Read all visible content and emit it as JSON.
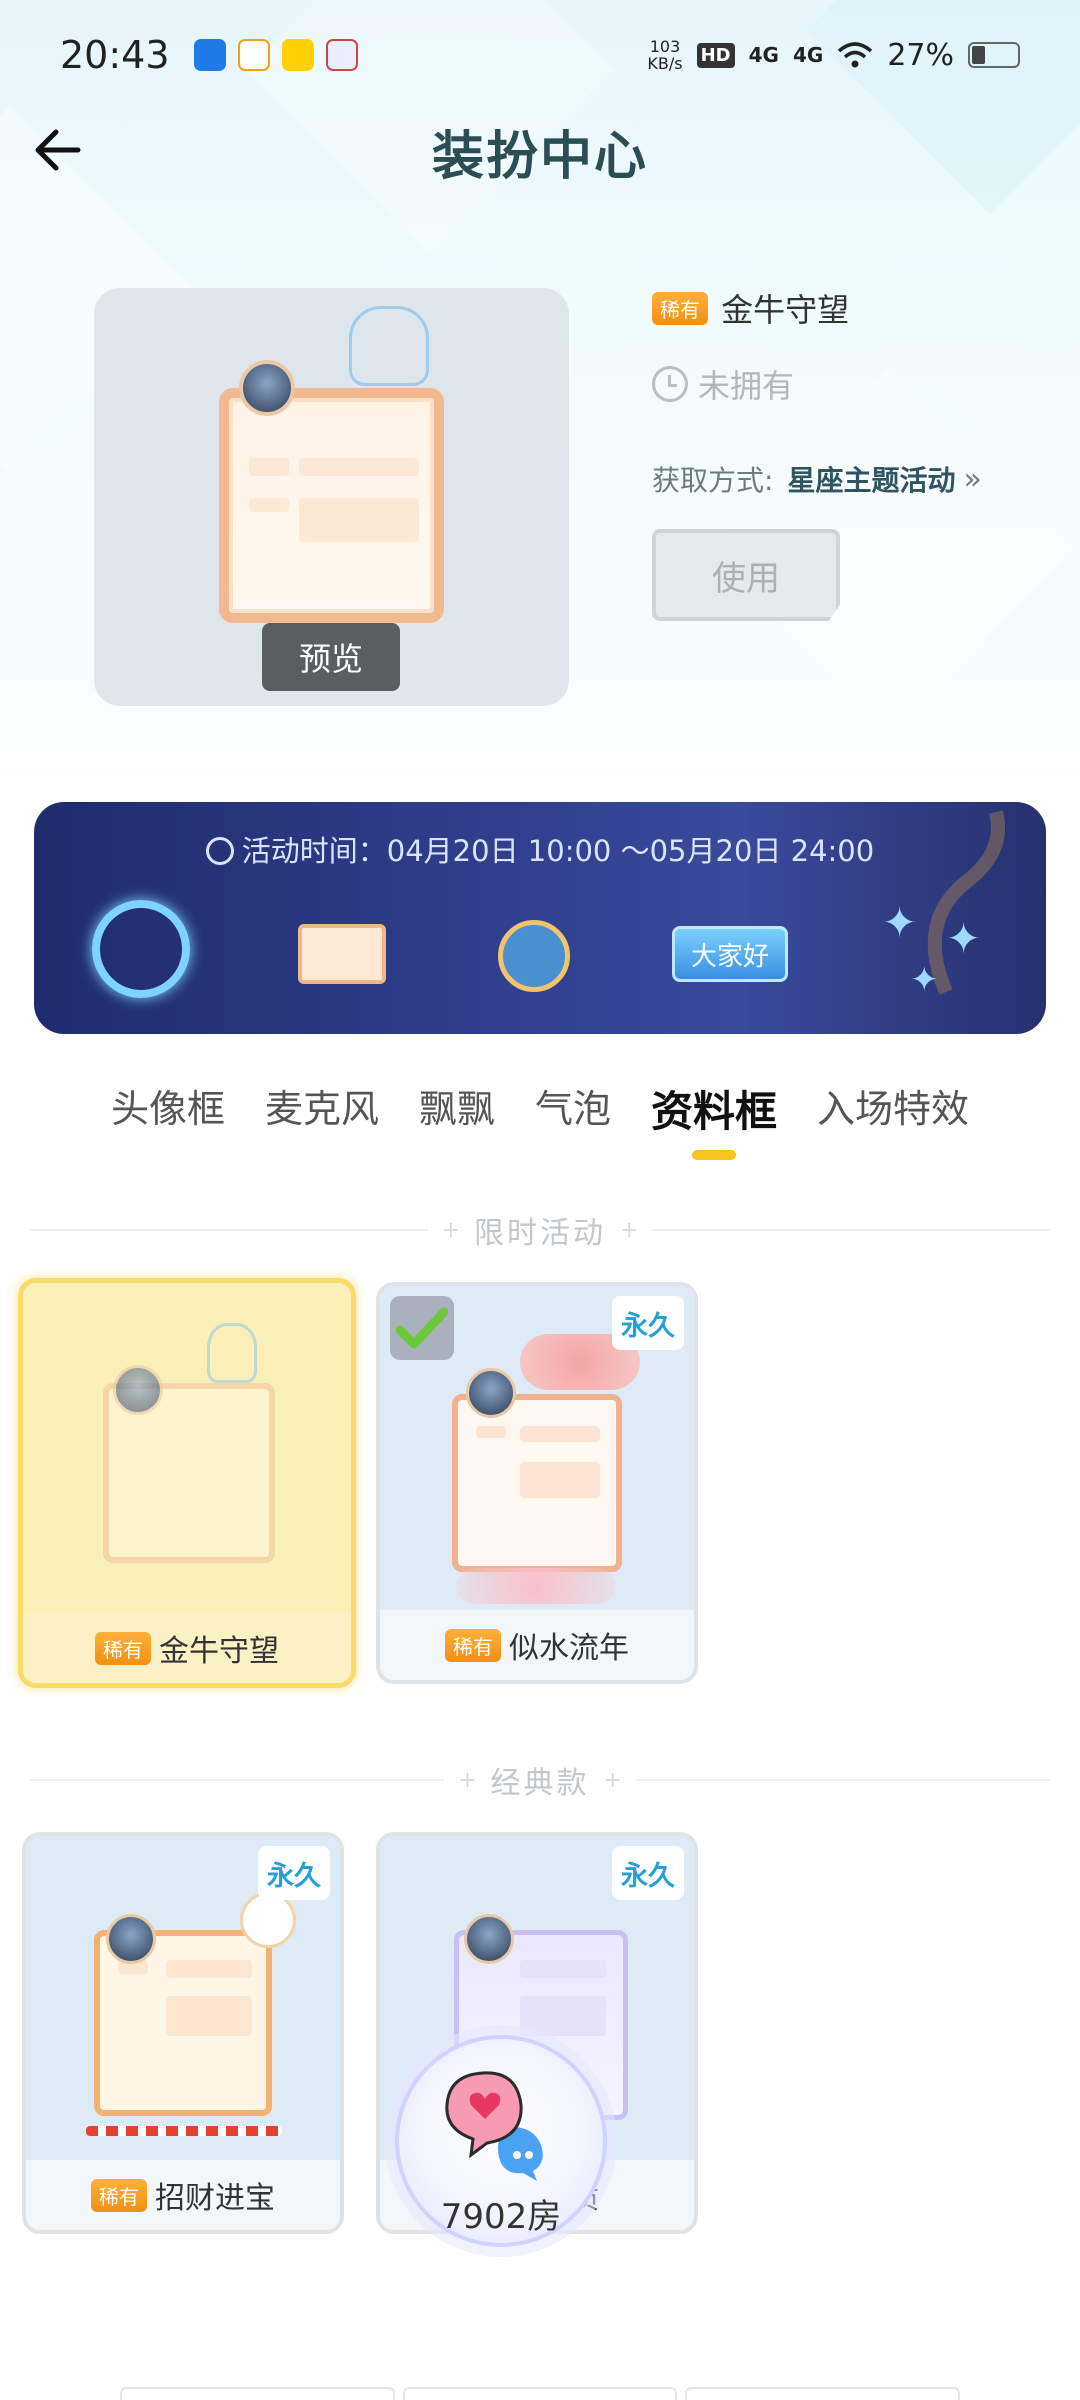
{
  "status_bar": {
    "time": "20:43",
    "net_speed_value": "103",
    "net_speed_unit": "KB/s",
    "hd_label": "HD",
    "signal_1": "4G",
    "signal_2": "4G",
    "battery_percent": "27%"
  },
  "header": {
    "title": "装扮中心",
    "back_icon": "back-arrow-icon"
  },
  "preview": {
    "button_label": "预览"
  },
  "item_info": {
    "rarity": "稀有",
    "name": "金牛守望",
    "ownership": "未拥有",
    "obtain_label": "获取方式:",
    "obtain_value": "星座主题活动",
    "obtain_arrow": "»",
    "use_button": "使用"
  },
  "banner": {
    "time_text": "活动时间：04月20日 10:00 ～05月20日 24:00",
    "bubble_text": "大家好"
  },
  "tabs": [
    {
      "label": "头像框",
      "active": false
    },
    {
      "label": "麦克风",
      "active": false
    },
    {
      "label": "飘飘",
      "active": false
    },
    {
      "label": "气泡",
      "active": false
    },
    {
      "label": "资料框",
      "active": true
    },
    {
      "label": "入场特效",
      "active": false
    }
  ],
  "sections": {
    "limited": "限时活动",
    "classic": "经典款"
  },
  "limited_items": [
    {
      "rarity": "稀有",
      "name": "金牛守望",
      "selected": true,
      "badge": ""
    },
    {
      "rarity": "稀有",
      "name": "似水流年",
      "selected": false,
      "badge": "永久",
      "equipped": true
    }
  ],
  "classic_items": [
    {
      "rarity": "稀有",
      "name": "招财进宝",
      "badge": "永久"
    },
    {
      "rarity": "稀有",
      "name": "惠质",
      "badge": "永久"
    }
  ],
  "floating_room": {
    "label": "7902房"
  },
  "colors": {
    "accent_yellow": "#f7c31d",
    "rare_orange": "#f19012",
    "permanent_blue": "#25a0d5",
    "title_teal": "#2a4d56"
  }
}
